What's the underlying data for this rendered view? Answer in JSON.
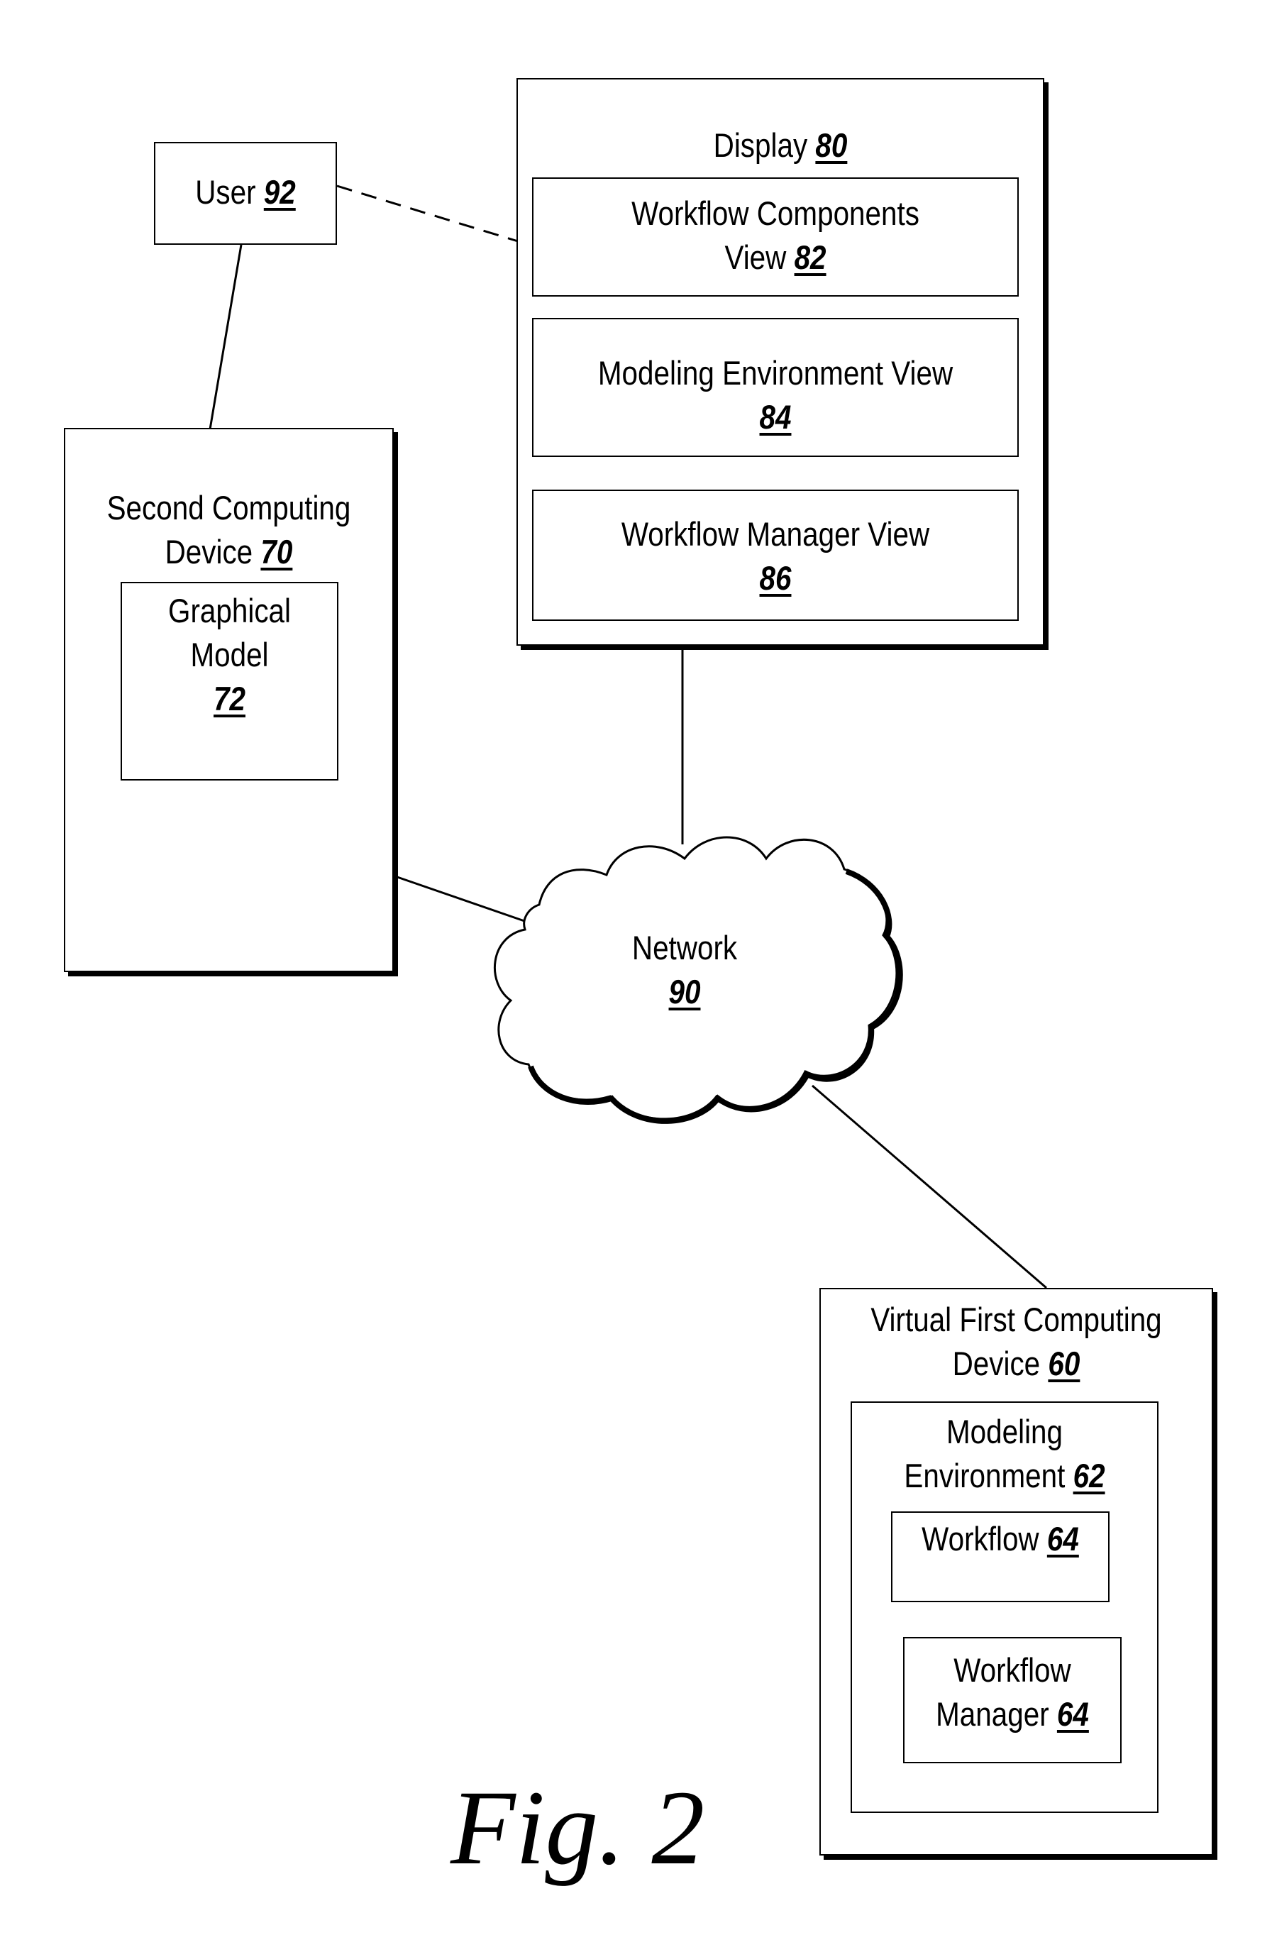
{
  "figure": {
    "caption": "Fig. 2"
  },
  "user": {
    "label": "User",
    "ref": "92"
  },
  "display": {
    "label": "Display",
    "ref": "80",
    "views": [
      {
        "label_line1": "Workflow Components",
        "label_line2": "View",
        "ref": "82"
      },
      {
        "label_line1": "Modeling Environment View",
        "ref": "84"
      },
      {
        "label_line1": "Workflow Manager View",
        "ref": "86"
      }
    ]
  },
  "second_device": {
    "label_line1": "Second Computing",
    "label_line2": "Device",
    "ref": "70",
    "model": {
      "label_line1": "Graphical",
      "label_line2": "Model",
      "ref": "72"
    }
  },
  "network": {
    "label": "Network",
    "ref": "90"
  },
  "first_device": {
    "label_line1": "Virtual First Computing",
    "label_line2": "Device",
    "ref": "60",
    "environment": {
      "label_line1": "Modeling",
      "label_line2": "Environment",
      "ref": "62",
      "workflow": {
        "label": "Workflow",
        "ref": "64"
      },
      "manager": {
        "label_line1": "Workflow",
        "label_line2": "Manager",
        "ref": "64"
      }
    }
  }
}
